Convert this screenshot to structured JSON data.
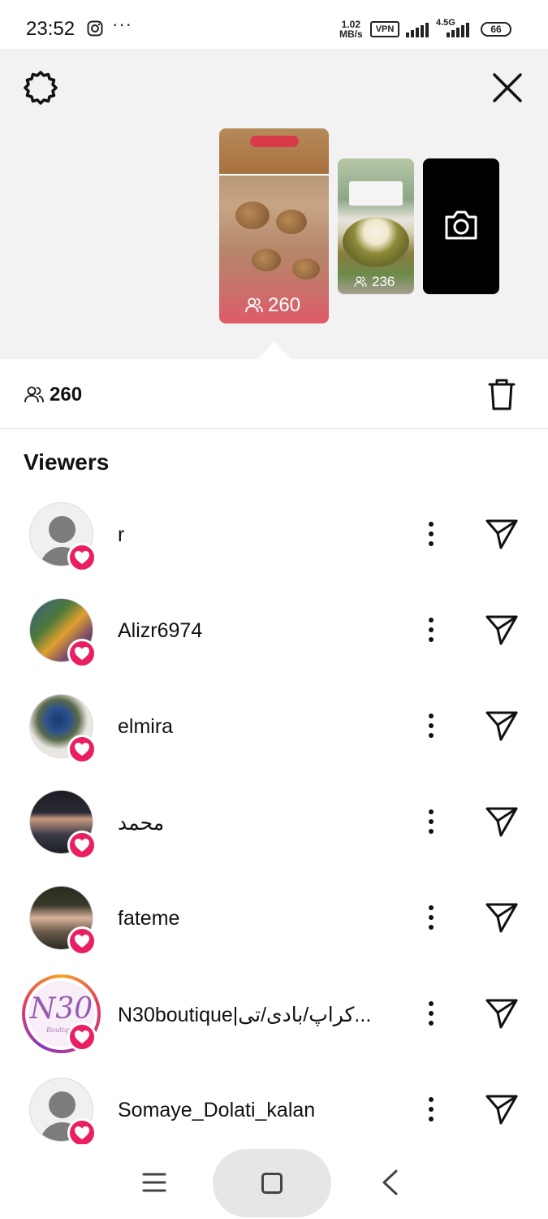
{
  "status_bar": {
    "time": "23:52",
    "more": "···",
    "speed_value": "1.02",
    "speed_unit": "MB/s",
    "vpn": "VPN",
    "network": "4.5G",
    "battery": "66"
  },
  "header": {
    "settings_icon": "gear-icon",
    "close_icon": "close-icon"
  },
  "stories": [
    {
      "viewers": "260",
      "selected": true
    },
    {
      "viewers": "236",
      "selected": false
    }
  ],
  "camera_icon": "camera-icon",
  "selected_story": {
    "viewer_count": "260",
    "delete_icon": "trash-icon"
  },
  "viewers_section": {
    "title": "Viewers",
    "items": [
      {
        "name": "r",
        "liked": true
      },
      {
        "name": "Alizr6974",
        "liked": true
      },
      {
        "name": "elmira",
        "liked": true
      },
      {
        "name": "محمد",
        "liked": true
      },
      {
        "name": "fateme",
        "liked": true
      },
      {
        "name": "N30boutique|کراپ/بادی/تی...",
        "liked": true
      },
      {
        "name": "Somaye_Dolati_kalan",
        "liked": true
      }
    ]
  },
  "brand_logo_text": {
    "main": "N30",
    "sub": "Boutique"
  },
  "colors": {
    "heart_badge": "#e91e63",
    "top_background": "#f2f2f2"
  },
  "nav_bar": {
    "menu_icon": "menu-icon",
    "home_icon": "home-square-icon",
    "back_icon": "back-chevron-icon"
  }
}
